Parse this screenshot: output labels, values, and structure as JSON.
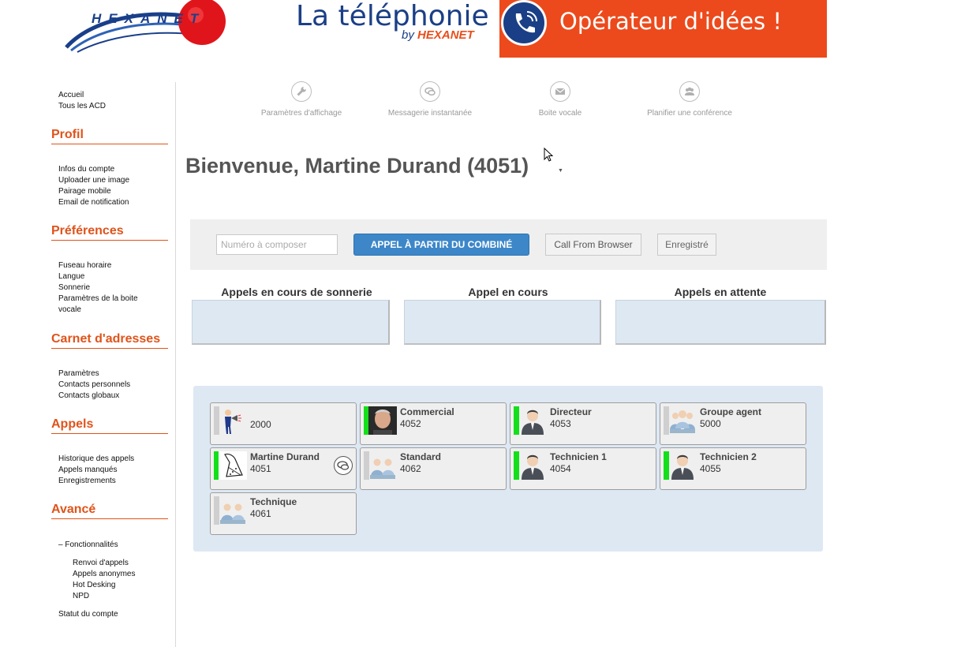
{
  "header": {
    "logo_text": "HEXANET",
    "banner_title": "La téléphonie",
    "banner_by": "by",
    "banner_brand": "HEXANET",
    "banner_slogan": "Opérateur d'idées !"
  },
  "sidebar": {
    "top_links": [
      "Accueil",
      "Tous les ACD"
    ],
    "sections": [
      {
        "title": "Profil",
        "items": [
          "Infos du compte",
          "Uploader une image",
          "Pairage mobile",
          "Email de notification"
        ]
      },
      {
        "title": "Préférences",
        "items": [
          "Fuseau horaire",
          "Langue",
          "Sonnerie",
          "Paramètres de la boite",
          "vocale"
        ]
      },
      {
        "title": "Carnet d'adresses",
        "items": [
          "Paramètres",
          "Contacts personnels",
          "Contacts globaux"
        ]
      },
      {
        "title": "Appels",
        "items": [
          "Historique des appels",
          "Appels manqués",
          "Enregistrements"
        ]
      },
      {
        "title": "Avancé",
        "items": [
          "– Fonctionnalités"
        ]
      }
    ],
    "advanced_sub": [
      "Renvoi d'appels",
      "Appels anonymes",
      "Hot Desking",
      "NPD"
    ],
    "account_status": "Statut du compte"
  },
  "toolbar": [
    {
      "label": "Paramètres d'affichage",
      "icon": "wrench-icon"
    },
    {
      "label": "Messagerie instantanée",
      "icon": "chat-icon"
    },
    {
      "label": "Boite vocale",
      "icon": "envelope-icon"
    },
    {
      "label": "Planifier une conférence",
      "icon": "group-icon"
    }
  ],
  "welcome": "Bienvenue, Martine Durand (4051)",
  "dial": {
    "placeholder": "Numéro à composer",
    "handset_button": "APPEL À PARTIR DU COMBINÉ",
    "browser_button": "Call From Browser",
    "record_button": "Enregistré"
  },
  "call_panels": [
    "Appels en cours de sonnerie",
    "Appel en cours",
    "Appels en attente"
  ],
  "extensions": [
    {
      "name": "",
      "number": "2000",
      "status": "off",
      "avatar": "announcer"
    },
    {
      "name": "Commercial",
      "number": "4052",
      "status": "on",
      "avatar": "photo"
    },
    {
      "name": "Directeur",
      "number": "4053",
      "status": "on",
      "avatar": "person"
    },
    {
      "name": "Groupe agent",
      "number": "5000",
      "status": "off",
      "avatar": "group"
    },
    {
      "name": "Martine Durand",
      "number": "4051",
      "status": "on",
      "avatar": "sketch"
    },
    {
      "name": "Standard",
      "number": "4062",
      "status": "off",
      "avatar": "duo"
    },
    {
      "name": "Technicien 1",
      "number": "4054",
      "status": "on",
      "avatar": "person"
    },
    {
      "name": "Technicien 2",
      "number": "4055",
      "status": "on",
      "avatar": "person"
    },
    {
      "name": "Technique",
      "number": "4061",
      "status": "off",
      "avatar": "duo"
    }
  ],
  "colors": {
    "accent": "#e0531a",
    "primary_button": "#3d87c9",
    "online": "#13e01a",
    "panel": "#dde8f3"
  }
}
